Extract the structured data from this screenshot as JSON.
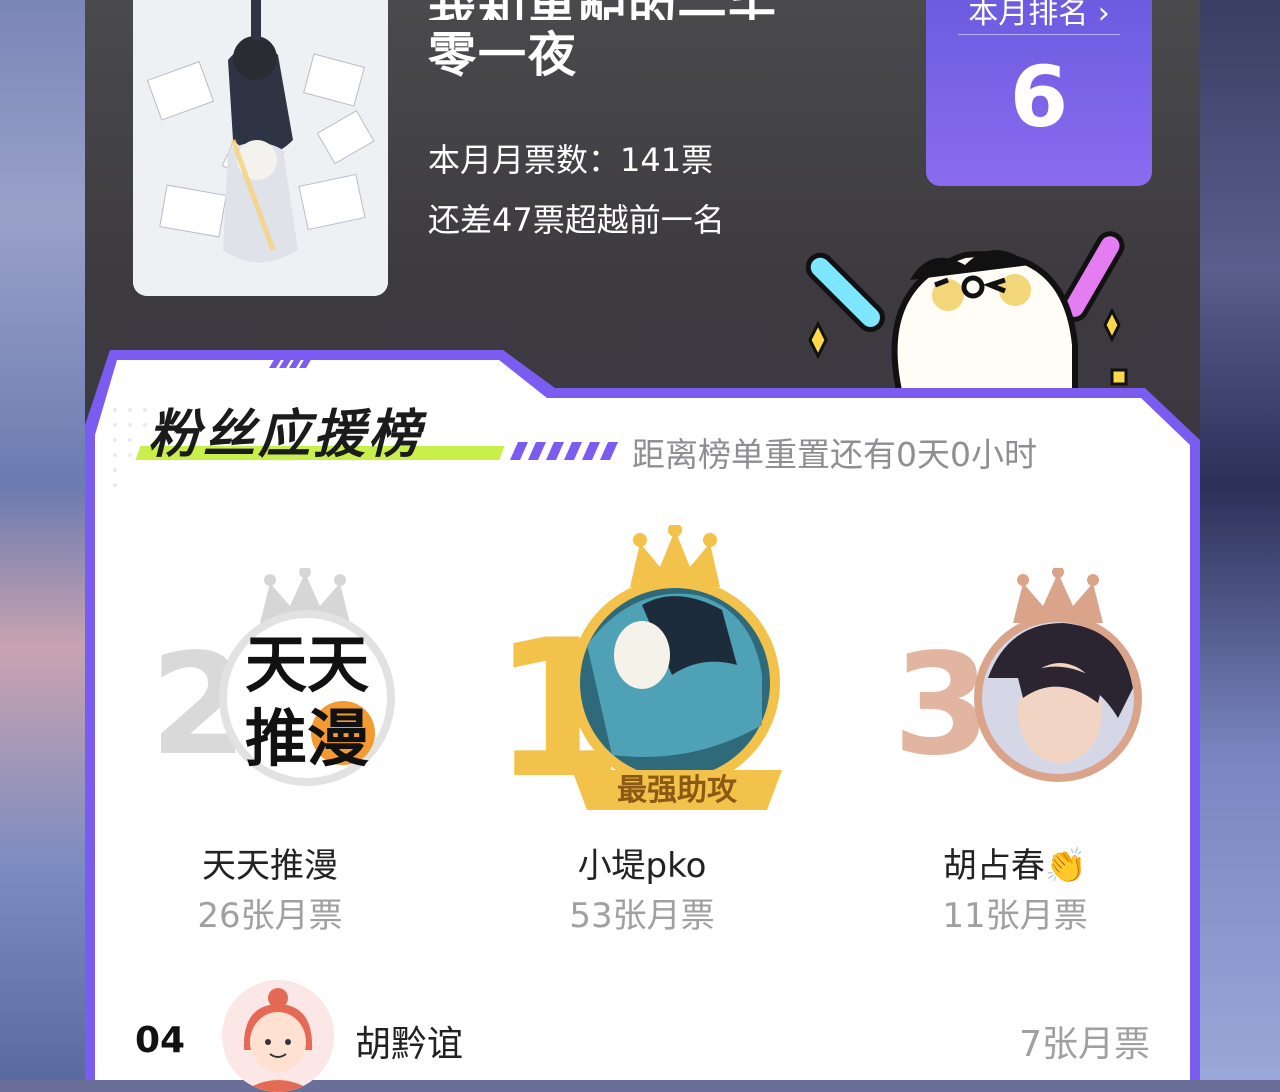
{
  "comic": {
    "title_line1": "我和男配的一千",
    "title_line2": "零一夜",
    "monthly_votes_label": "本月月票数：141票",
    "gap_label": "还差47票超越前一名"
  },
  "rank_badge": {
    "label": "本月排名 ›",
    "value": "6"
  },
  "fan_board": {
    "title": "粉丝应援榜",
    "reset_text": "距离榜单重置还有0天0小时"
  },
  "podium": [
    {
      "rank": "2",
      "name": "天天推漫",
      "votes": "26张月票",
      "avatar_text": "天天推漫"
    },
    {
      "rank": "1",
      "name": "小堤pko",
      "votes": "53张月票",
      "ribbon": "最强助攻"
    },
    {
      "rank": "3",
      "name": "胡占春👏",
      "votes": "11张月票"
    }
  ],
  "list": [
    {
      "rank": "04",
      "name": "胡黔谊",
      "votes": "7张月票"
    }
  ],
  "colors": {
    "accent_purple": "#7b5cf0",
    "lime": "#c8ef4a",
    "gold": "#f2c24b",
    "silver": "#d6d6d6",
    "bronze": "#d9a48a"
  }
}
